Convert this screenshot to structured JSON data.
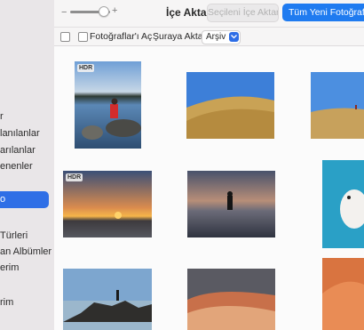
{
  "sidebar": {
    "items": [
      {
        "label": "r"
      },
      {
        "label": "lanılanlar"
      },
      {
        "label": "arılanlar"
      },
      {
        "label": "enenler"
      },
      {
        "label": "o"
      },
      {
        "label": "Türleri"
      },
      {
        "label": "an Albümler"
      },
      {
        "label": "erim"
      },
      {
        "label": "rim"
      }
    ]
  },
  "toolbar": {
    "zoom_minus": "−",
    "zoom_plus": "+",
    "zoom_level": 0.75,
    "title": "İçe Aktar",
    "import_selected_label": "Seçileni İçe Aktar",
    "import_all_label": "Tüm Yeni Fotoğrafları İçe Aktar"
  },
  "options": {
    "open_photos_label": "Fotoğraflar'ı Aç",
    "import_to_label": "Şuraya Aktar:",
    "import_to_value": "Arşiv"
  },
  "photos": [
    {
      "scene": "lake-sunrise-person",
      "badge": "HDR"
    },
    {
      "scene": "golden-hill"
    },
    {
      "scene": "field-walker"
    },
    {
      "scene": "beach-sunset",
      "badge": "HDR"
    },
    {
      "scene": "beach-runner"
    },
    {
      "scene": "dog-blue"
    },
    {
      "scene": "rock-shore"
    },
    {
      "scene": "sandstone-waves"
    },
    {
      "scene": "red-dunes"
    }
  ],
  "colors": {
    "accent": "#1f7bf0",
    "sidebar_selected": "#2f6fe6"
  }
}
